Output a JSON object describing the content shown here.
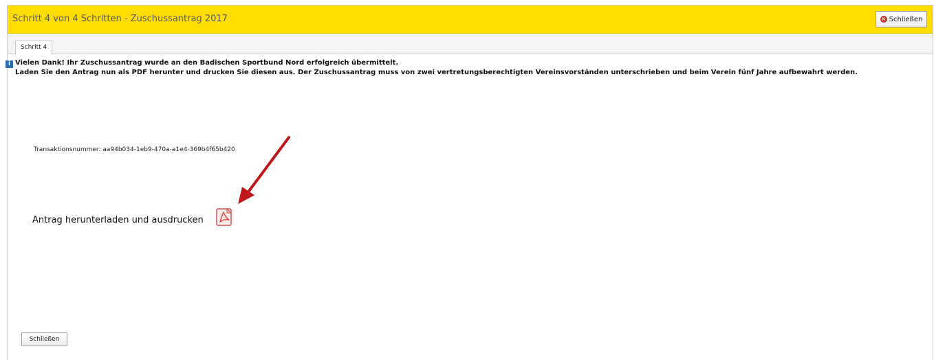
{
  "window": {
    "title": "Schritt 4 von 4 Schritten - Zuschussantrag 2017",
    "close_label": "Schließen"
  },
  "tabs": [
    {
      "label": "Schritt 4"
    }
  ],
  "message": {
    "line1": "Vielen Dank! Ihr Zuschussantrag wurde an den Badischen Sportbund Nord erfolgreich übermittelt.",
    "line2": "Laden Sie den Antrag nun als PDF herunter und drucken Sie diesen aus. Der Zuschussantrag muss von zwei vertretungsberechtigten Vereinsvorständen unterschrieben und beim Verein fünf Jahre aufbewahrt werden."
  },
  "transaction": {
    "text": "Transaktionsnummer: aa94b034-1eb9-470a-a1e4-369b4f65b420"
  },
  "download": {
    "label": "Antrag herunterladen und ausdrucken"
  },
  "footer": {
    "close_label": "Schließen"
  },
  "colors": {
    "titlebar": "#ffdd00",
    "arrow": "#c0171b",
    "pdf": "#d9534f"
  },
  "icons": {
    "close": "close-circle-icon",
    "info": "info-icon",
    "pdf": "pdf-icon",
    "arrow": "arrow-icon"
  }
}
